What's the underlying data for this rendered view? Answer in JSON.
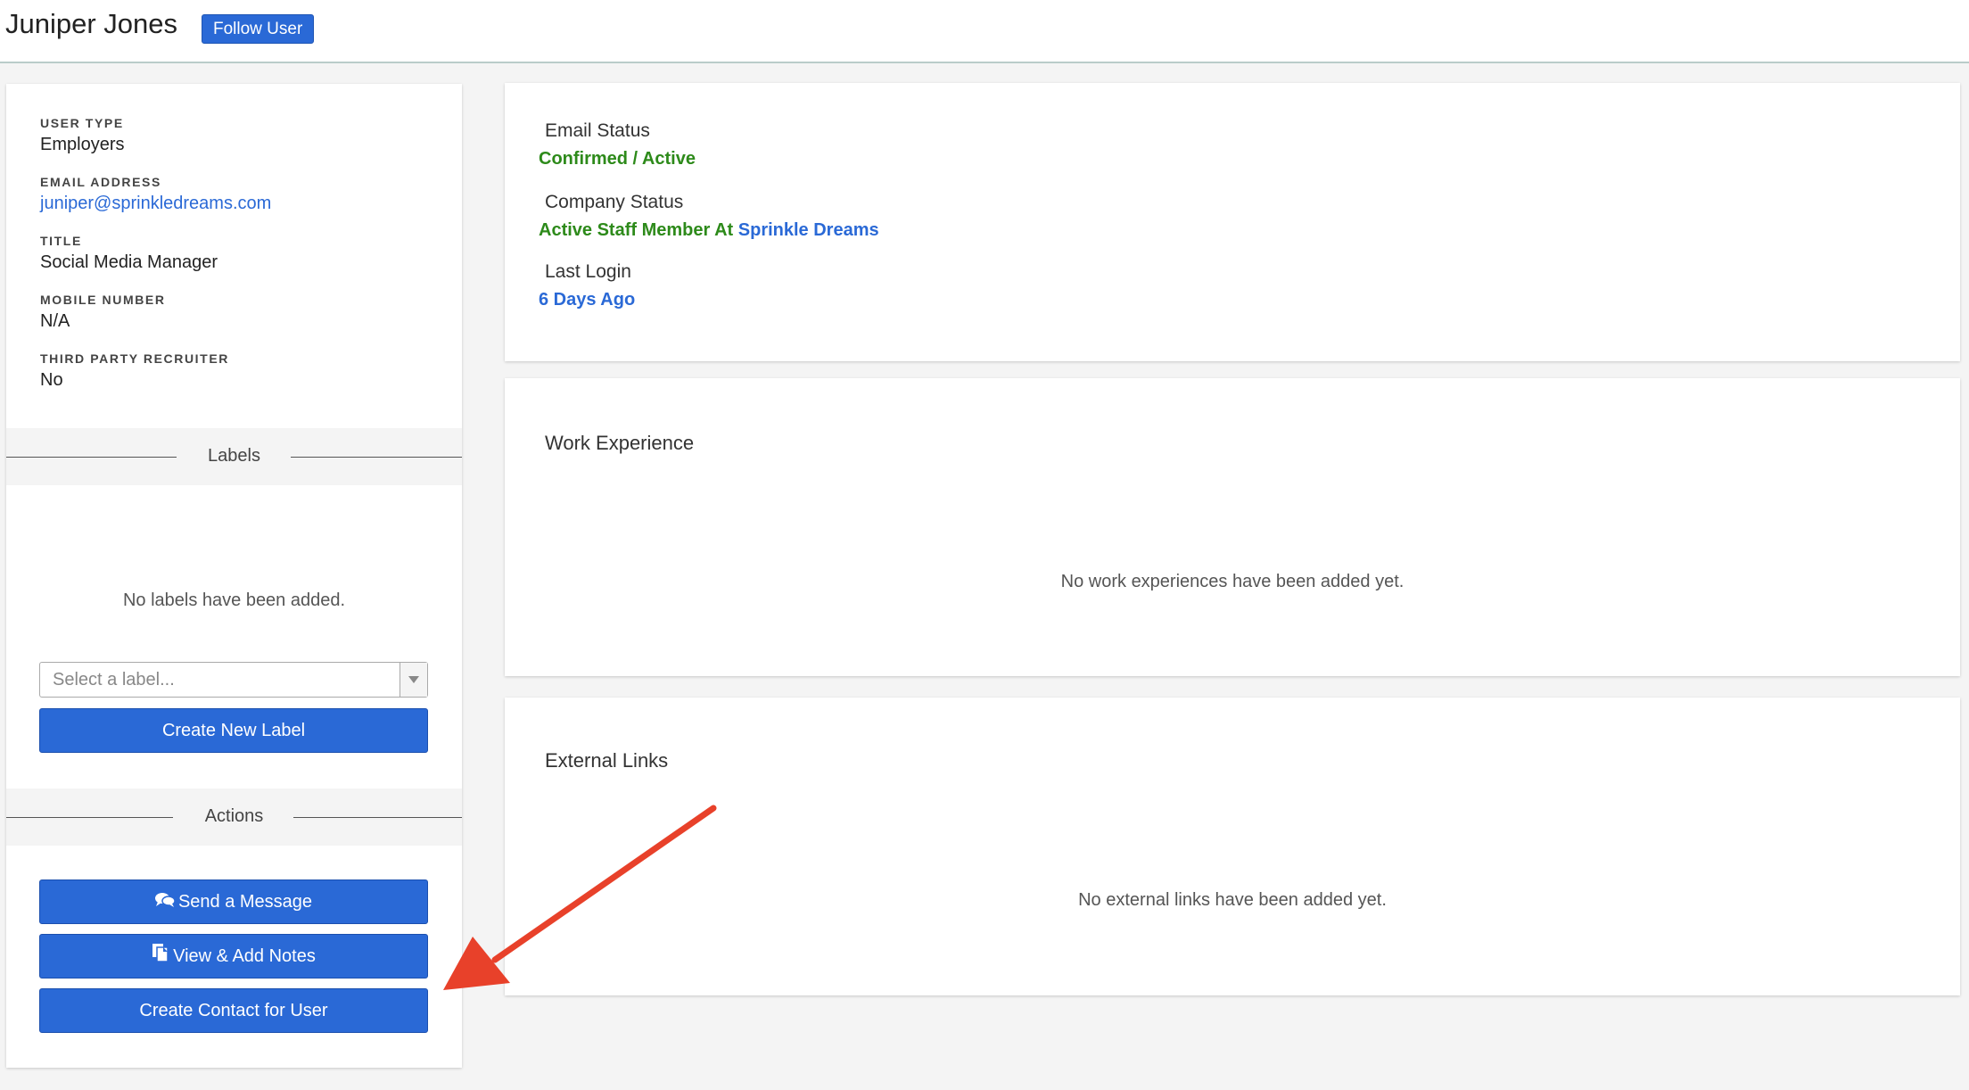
{
  "header": {
    "user_name": "Juniper Jones",
    "follow_label": "Follow User"
  },
  "profile": {
    "user_type": {
      "label": "USER TYPE",
      "value": "Employers"
    },
    "email": {
      "label": "EMAIL ADDRESS",
      "value": "juniper@sprinkledreams.com"
    },
    "title": {
      "label": "TITLE",
      "value": "Social Media Manager"
    },
    "mobile": {
      "label": "MOBILE NUMBER",
      "value": "N/A"
    },
    "third_party": {
      "label": "THIRD PARTY RECRUITER",
      "value": "No"
    }
  },
  "labels": {
    "heading": "Labels",
    "empty_text": "No labels have been added.",
    "select_placeholder": "Select a label...",
    "create_button": "Create New Label"
  },
  "actions": {
    "heading": "Actions",
    "send_message": "Send a Message",
    "view_notes": "View & Add Notes",
    "create_contact": "Create Contact for User"
  },
  "status": {
    "email_label": "Email Status",
    "email_value": "Confirmed / Active",
    "company_label": "Company Status",
    "company_prefix": "Active Staff Member At",
    "company_name": "Sprinkle Dreams",
    "login_label": "Last Login",
    "login_value": "6 Days Ago"
  },
  "work_experience": {
    "title": "Work Experience",
    "empty_text": "No work experiences have been added yet."
  },
  "external_links": {
    "title": "External Links",
    "empty_text": "No external links have been added yet."
  },
  "colors": {
    "primary": "#2a69d6",
    "success": "#2d8a1a",
    "annotation_arrow": "#e8412a"
  }
}
